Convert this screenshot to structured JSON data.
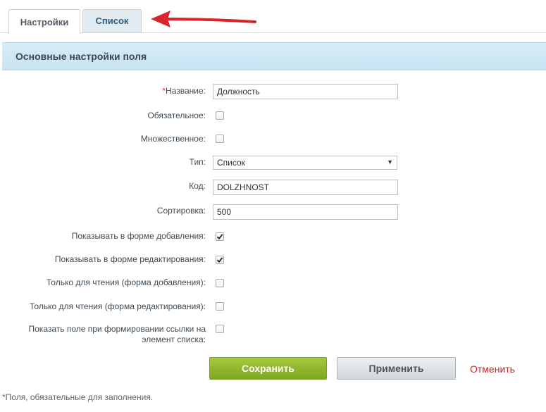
{
  "tabs": [
    {
      "label": "Настройки",
      "active": true
    },
    {
      "label": "Список",
      "active": false
    }
  ],
  "section": {
    "title": "Основные настройки поля"
  },
  "form": {
    "name": {
      "required_mark": "*",
      "label": "Название:",
      "value": "Должность"
    },
    "mandatory": {
      "label": "Обязательное:",
      "checked": false
    },
    "multiple": {
      "label": "Множественное:",
      "checked": false
    },
    "type": {
      "label": "Тип:",
      "value": "Список"
    },
    "code": {
      "label": "Код:",
      "value": "DOLZHNOST"
    },
    "sort": {
      "label": "Сортировка:",
      "value": "500"
    },
    "show_add": {
      "label": "Показывать в форме добавления:",
      "checked": true
    },
    "show_edit": {
      "label": "Показывать в форме редактирования:",
      "checked": true
    },
    "readonly_add": {
      "label": "Только для чтения (форма добавления):",
      "checked": false
    },
    "readonly_edit": {
      "label": "Только для чтения (форма редактирования):",
      "checked": false
    },
    "show_link": {
      "label_line1": "Показать поле при формировании ссылки на",
      "label_line2": "элемент списка:",
      "checked": false
    }
  },
  "buttons": {
    "save": "Сохранить",
    "apply": "Применить",
    "cancel": "Отменить"
  },
  "footnote": {
    "mark": "*",
    "text": "Поля, обязательные для заполнения."
  },
  "colors": {
    "accent_green": "#8db52c",
    "cancel_red": "#c3272a",
    "arrow_red": "#d8262b",
    "header_blue": "#cfe8f5"
  }
}
